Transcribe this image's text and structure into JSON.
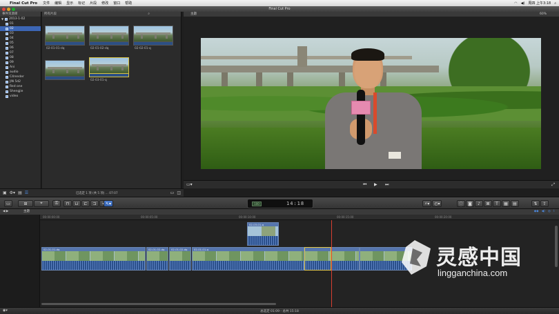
{
  "menubar": {
    "app_name": "Final Cut Pro",
    "items": [
      "文件",
      "编辑",
      "显示",
      "标记",
      "片段",
      "修改",
      "窗口",
      "帮助"
    ],
    "clock": "周四 上午3:18"
  },
  "window": {
    "title": "Final Cut Pro"
  },
  "library": {
    "header": "事件资源库",
    "root": "2013-1-02",
    "events": [
      "01",
      "02",
      "03",
      "04",
      "05",
      "06",
      "07",
      "08",
      "09",
      "Ani",
      "audio",
      "C4render",
      "JIN 5d2",
      "Red one",
      "Shengjie",
      "video"
    ],
    "selected_index": 1
  },
  "browser": {
    "header": "所有片段",
    "clips": [
      {
        "label": "02-01-01-dq"
      },
      {
        "label": "02-01-02-dq"
      },
      {
        "label": "02-02-01-q"
      },
      {
        "label": ""
      },
      {
        "label": "02-03-01-q"
      }
    ],
    "footer_caption": "已选定 1 项 (共 5 项) ... 07:07"
  },
  "viewer": {
    "header": "主题",
    "zoom": "60%",
    "controls": {
      "prev": "⏮",
      "play": "▶",
      "next": "⏭"
    }
  },
  "toolbar": {
    "timecode_label": "100",
    "timecode_value": "14:18"
  },
  "timeline": {
    "project": "主题",
    "ruler_ticks": [
      "00:00:00:00",
      "00:00:05:00",
      "00:00:10:00",
      "00:00:15:00",
      "00:00:20:00"
    ],
    "connected_clip": "02-03-01-q",
    "primary_clips": [
      {
        "name": "02-01-01-dq"
      },
      {
        "name": "02-01-02-dq"
      },
      {
        "name": "02-01-02-dq"
      },
      {
        "name": "02-01-01-q"
      },
      {
        "name": ""
      },
      {
        "name": ""
      },
      {
        "name": ""
      }
    ]
  },
  "statusbar": {
    "text": "总选定 01:09 - 总共 15:18"
  },
  "watermark": {
    "cn": "灵感中国",
    "en": "lingganchina.com"
  },
  "colors": {
    "accent": "#3c66b5",
    "selection": "#e0c64a",
    "playhead": "#d94030"
  }
}
